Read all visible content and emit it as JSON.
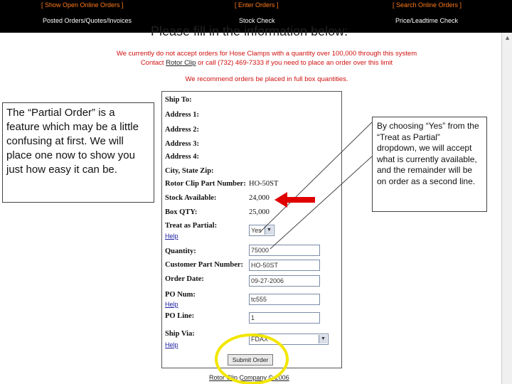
{
  "nav": {
    "top": [
      "[ Show Open Online Orders ]",
      "[ Enter Orders ]",
      "[ Search Online Orders ]"
    ],
    "bottom": [
      "Posted Orders/Quotes/Invoices",
      "Stock Check",
      "Price/Leadtime Check"
    ]
  },
  "page": {
    "title": "Please fill in the information below:",
    "notice_line1": "We currently do not accept orders for Hose Clamps with a quantity over 100,000 through this system",
    "notice_line2_pre": "Contact ",
    "notice_line2_link": "Rotor Clip",
    "notice_line2_post": " or call (732) 469-7333 if you need to place an order over this limit",
    "notice_line3": "We recommend orders be placed in full box quantities."
  },
  "form": {
    "ship_to": "Ship To:",
    "address1": "Address 1:",
    "address2": "Address 2:",
    "address3": "Address 3:",
    "address4": "Address 4:",
    "city": "City, State Zip:",
    "part_label": "Rotor Clip Part Number:",
    "part_value": "HO-50ST",
    "stock_label": "Stock Available:",
    "stock_value": "24,000",
    "box_label": "Box QTY:",
    "box_value": "25,000",
    "treat_label": "Treat as Partial:",
    "treat_value": "Yes",
    "help": "Help",
    "quantity_label": "Quantity:",
    "quantity_value": "75000",
    "cust_part_label": "Customer Part Number:",
    "cust_part_value": "HO-50ST",
    "order_date_label": "Order Date:",
    "order_date_value": "09-27-2006",
    "po_num_label": "PO Num:",
    "po_num_value": "tc555",
    "po_line_label": "PO Line:",
    "po_line_value": "1",
    "ship_via_label": "Ship Via:",
    "ship_via_value": "FDAX",
    "submit": "Submit Order"
  },
  "callouts": {
    "left": "The “Partial Order” is a feature which may be a little confusing at first.  We will place one now to show you just how easy it can be.",
    "right": "By choosing “Yes” from the “Treat as Partial” dropdown, we will accept what is currently available, and the remainder will be on order as a second line."
  },
  "footer": "Rotor Clip Company © 2006",
  "colors": {
    "nav_bg": "#000000",
    "nav_top": "#ff7a1a",
    "notice": "#d01010",
    "arrow": "#e00000",
    "highlight": "#f2e600"
  }
}
